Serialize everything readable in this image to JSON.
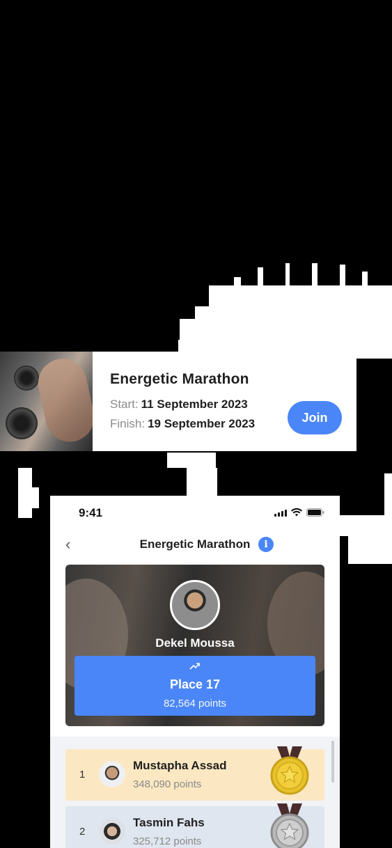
{
  "event_card": {
    "title": "Energetic Marathon",
    "start_label": "Start:",
    "start_value": "11 September 2023",
    "finish_label": "Finish:",
    "finish_value": "19 September 2023",
    "join_label": "Join"
  },
  "phone": {
    "status_time": "9:41",
    "nav_title": "Energetic Marathon",
    "info_icon_text": "i",
    "back_icon_text": "‹",
    "user": {
      "name": "Dekel Moussa",
      "place": "Place 17",
      "points": "82,564 points"
    },
    "leaderboard": [
      {
        "rank": "1",
        "name": "Mustapha Assad",
        "points": "348,090 points",
        "medal": "gold"
      },
      {
        "rank": "2",
        "name": "Tasmin Fahs",
        "points": "325,712 points",
        "medal": "silver"
      }
    ]
  },
  "colors": {
    "accent": "#4a86f7",
    "gold_row": "#fbe8c2",
    "silver_row": "#dfe6ef",
    "gold_medal": "#e8c22b",
    "silver_medal": "#b9b9b9",
    "ribbon": "#4a2c2c"
  }
}
